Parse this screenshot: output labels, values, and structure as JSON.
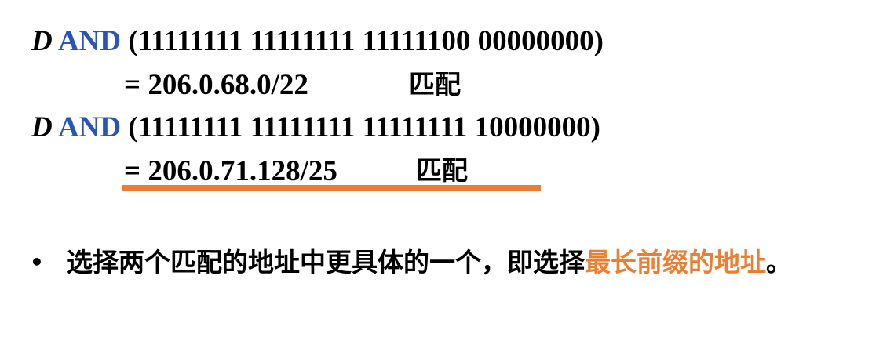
{
  "rows": [
    {
      "var": "D",
      "kw": "AND",
      "mask": "(11111111 11111111 11111100 00000000)"
    },
    {
      "result": "= 206.0.68.0/22",
      "status": "匹配"
    },
    {
      "var": "D",
      "kw": "AND",
      "mask": "(11111111 11111111 11111111 10000000)"
    },
    {
      "result": "= 206.0.71.128/25",
      "status": "匹配"
    }
  ],
  "bullet": {
    "symbol": "•",
    "text_plain": "选择两个匹配的地址中更具体的一个，即选择",
    "text_highlight": "最长前缀的地址",
    "text_end": "。"
  },
  "colors": {
    "keyword": "#2a54b8",
    "highlight": "#ed7d31",
    "underline": "#ed7d31"
  }
}
